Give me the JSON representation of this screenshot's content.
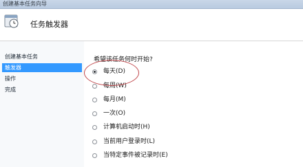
{
  "window": {
    "title": "创建基本任务向导"
  },
  "header": {
    "title": "任务触发器",
    "icon": "task-scheduler-icon"
  },
  "sidebar": {
    "items": [
      {
        "label": "创建基本任务",
        "active": false
      },
      {
        "label": "触发器",
        "active": true
      },
      {
        "label": "操作",
        "active": false
      },
      {
        "label": "完成",
        "active": false
      }
    ]
  },
  "main": {
    "question": "希望该任务何时开始?",
    "options": [
      {
        "label": "每天(D)",
        "checked": true
      },
      {
        "label": "每周(W)",
        "checked": false
      },
      {
        "label": "每月(M)",
        "checked": false
      },
      {
        "label": "一次(O)",
        "checked": false
      },
      {
        "label": "计算机启动时(H)",
        "checked": false
      },
      {
        "label": "当前用户登录时(L)",
        "checked": false
      },
      {
        "label": "当特定事件被记录时(E)",
        "checked": false
      }
    ]
  },
  "colors": {
    "active_nav": "#3399ff",
    "annotation": "#c0474b"
  }
}
